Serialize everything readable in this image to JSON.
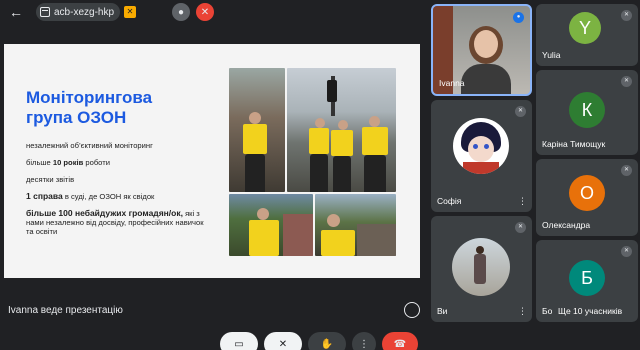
{
  "meeting": {
    "code": "acb-xezg-hkp",
    "presenting_label": "Ivanna веде презентацію"
  },
  "slide": {
    "title_line1": "Моніторингова",
    "title_line2": "група ОЗОН",
    "line1": "незалежний об’єктивний моніторинг",
    "line2_pre": "більше ",
    "line2_bold": "10 років",
    "line2_post": " роботи",
    "line3": "десятки звітів",
    "line4_bold": "1 справа",
    "line4_post": " в суді, де ОЗОН як свідок",
    "line5_bold": "більше 100 небайдужих громадян/ок,",
    "line5_post": " які з нами незалежно від досвіду, професійних навичок та освіти"
  },
  "participants": [
    {
      "name": "Ivanna",
      "letter": ""
    },
    {
      "name": "Yulia",
      "letter": "Y",
      "color": "#7cb342"
    },
    {
      "name": "Каріна Тимощук",
      "letter": "К",
      "color": "#2e7d32"
    },
    {
      "name": "Софія",
      "letter": ""
    },
    {
      "name": "Олександра",
      "letter": "О",
      "color": "#e8710a"
    },
    {
      "name": "Ви",
      "letter": ""
    },
    {
      "name": "Бо",
      "letter": "Б",
      "color": "#00897b"
    }
  ],
  "more_participants": "Ще 10 учасників",
  "icons": {
    "back": "arrow-left-icon",
    "calendar": "calendar-icon",
    "present": "present-icon",
    "mic": "mic-off-icon",
    "camera": "camera-off-icon",
    "hand": "raise-hand-icon",
    "more": "more-vert-icon",
    "end": "end-call-icon"
  }
}
